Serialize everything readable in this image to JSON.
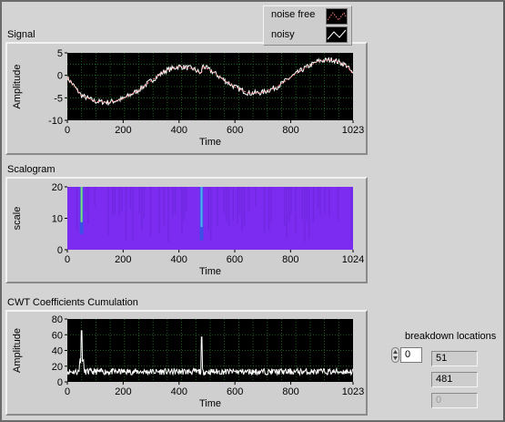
{
  "signal": {
    "title": "Signal",
    "ylabel": "Amplitude",
    "xlabel": "Time",
    "xticks": [
      "0",
      "200",
      "400",
      "600",
      "800",
      "1023"
    ],
    "yticks": [
      "5",
      "0",
      "-5",
      "-10"
    ]
  },
  "legend": {
    "items": [
      {
        "label": "noise free",
        "color": "#ff8080"
      },
      {
        "label": "noisy",
        "color": "#ffffff"
      }
    ]
  },
  "scalogram": {
    "title": "Scalogram",
    "ylabel": "scale",
    "xlabel": "Time",
    "xticks": [
      "0",
      "200",
      "400",
      "600",
      "800",
      "1024"
    ],
    "yticks": [
      "20",
      "10",
      "0"
    ]
  },
  "cwt": {
    "title": "CWT Coefficients Cumulation",
    "ylabel": "Amplitude",
    "xlabel": "Time",
    "xticks": [
      "0",
      "200",
      "400",
      "600",
      "800",
      "1023"
    ],
    "yticks": [
      "80",
      "60",
      "40",
      "20",
      "0"
    ]
  },
  "breakdown": {
    "title": "breakdown locations",
    "index": "0",
    "values": [
      "51",
      "481",
      "0"
    ]
  },
  "colors": {
    "plot_bg": "#000000",
    "grid": "#1f7a1f",
    "scalogram_fill": "#7b2cf0",
    "noisy_line": "#ffffff",
    "clean_line": "#ff8080"
  },
  "chart_data": [
    {
      "type": "line",
      "title": "Signal",
      "xlabel": "Time",
      "ylabel": "Amplitude",
      "xlim": [
        0,
        1023
      ],
      "ylim": [
        -10,
        5
      ],
      "series": [
        {
          "name": "noise free",
          "x": [
            0,
            51,
            100,
            150,
            200,
            250,
            300,
            350,
            400,
            450,
            481,
            482,
            520,
            560,
            600,
            650,
            700,
            750,
            800,
            850,
            900,
            950,
            1000,
            1023
          ],
          "y": [
            -0.5,
            -4.5,
            -5.8,
            -6.0,
            -5.2,
            -3.5,
            -1.2,
            1.0,
            2.0,
            1.5,
            0.3,
            2.2,
            0.8,
            -1.0,
            -2.6,
            -4.0,
            -3.8,
            -2.6,
            -0.4,
            1.6,
            3.2,
            3.5,
            2.2,
            0.2
          ]
        },
        {
          "name": "noisy",
          "x": [
            0,
            51,
            100,
            150,
            200,
            250,
            300,
            350,
            400,
            450,
            481,
            482,
            520,
            560,
            600,
            650,
            700,
            750,
            800,
            850,
            900,
            950,
            1000,
            1023
          ],
          "y": [
            -0.5,
            -4.5,
            -5.8,
            -6.0,
            -5.2,
            -3.5,
            -1.2,
            1.0,
            2.0,
            1.5,
            0.3,
            2.2,
            0.8,
            -1.0,
            -2.6,
            -4.0,
            -3.8,
            -2.6,
            -0.4,
            1.6,
            3.2,
            3.5,
            2.2,
            0.2
          ]
        }
      ]
    },
    {
      "type": "heatmap",
      "title": "Scalogram",
      "xlabel": "Time",
      "ylabel": "scale",
      "xlim": [
        0,
        1024
      ],
      "ylim": [
        0,
        20
      ],
      "hotspots": [
        {
          "x": 51,
          "ymin": 5,
          "ymax": 20
        },
        {
          "x": 481,
          "ymin": 3,
          "ymax": 20
        }
      ]
    },
    {
      "type": "line",
      "title": "CWT Coefficients Cumulation",
      "xlabel": "Time",
      "ylabel": "Amplitude",
      "xlim": [
        0,
        1023
      ],
      "ylim": [
        0,
        80
      ],
      "series": [
        {
          "x": [
            0,
            20,
            40,
            51,
            60,
            80,
            100,
            150,
            200,
            250,
            300,
            350,
            400,
            450,
            481,
            500,
            550,
            600,
            650,
            700,
            750,
            800,
            850,
            900,
            950,
            1000,
            1023
          ],
          "y": [
            12,
            15,
            20,
            65,
            14,
            10,
            12,
            11,
            13,
            12,
            10,
            11,
            13,
            12,
            57,
            13,
            12,
            11,
            12,
            10,
            12,
            13,
            11,
            12,
            10,
            12,
            11
          ]
        }
      ]
    }
  ]
}
